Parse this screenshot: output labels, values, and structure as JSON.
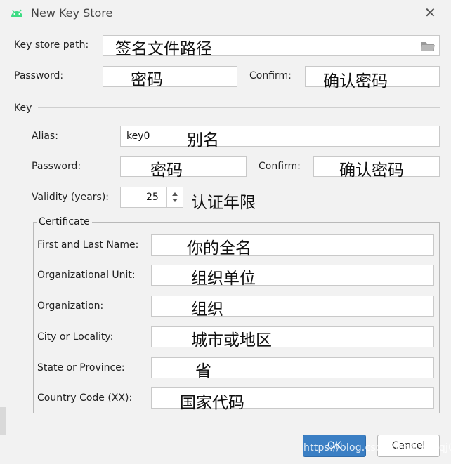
{
  "dialog": {
    "title": "New Key Store",
    "icon": "android-icon",
    "close_icon": "close-icon"
  },
  "keystore": {
    "path_label": "Key store path:",
    "path_hint": "签名文件路径",
    "folder_icon": "folder-icon",
    "password_label": "Password:",
    "password_hint": "密码",
    "confirm_label": "Confirm:",
    "confirm_hint": "确认密码"
  },
  "key": {
    "section_label": "Key",
    "alias_label": "Alias:",
    "alias_value": "key0",
    "alias_hint": "别名",
    "password_label": "Password:",
    "password_hint": "密码",
    "confirm_label": "Confirm:",
    "confirm_hint": "确认密码",
    "validity_label": "Validity (years):",
    "validity_value": "25",
    "validity_hint": "认证年限"
  },
  "certificate": {
    "group_label": "Certificate",
    "fields": [
      {
        "label": "First and Last Name:",
        "hint": "你的全名"
      },
      {
        "label": "Organizational Unit:",
        "hint": "组织单位"
      },
      {
        "label": "Organization:",
        "hint": "组织"
      },
      {
        "label": "City or Locality:",
        "hint": "城市或地区"
      },
      {
        "label": "State or Province:",
        "hint": "省"
      },
      {
        "label": "Country Code (XX):",
        "hint": "国家代码"
      }
    ]
  },
  "buttons": {
    "ok": "OK",
    "cancel": "Cancel"
  },
  "watermark": "https://blog.csdn.net/ktxsaqj0"
}
